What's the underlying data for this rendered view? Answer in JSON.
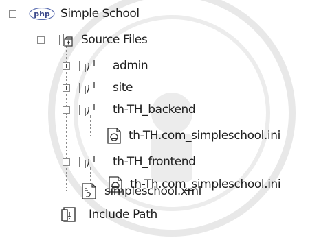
{
  "tree": {
    "root": {
      "label": "Simple School",
      "icon": "php-project-icon",
      "icon_text": "php",
      "expanded": true
    },
    "source_files": {
      "label": "Source Files",
      "icon": "source-folder-icon",
      "expanded": true
    },
    "admin": {
      "label": "admin",
      "icon": "package-folder-icon",
      "expanded": false
    },
    "site": {
      "label": "site",
      "icon": "package-folder-icon",
      "expanded": false
    },
    "th_backend": {
      "label": "th-TH_backend",
      "icon": "package-folder-icon",
      "expanded": true,
      "children": [
        {
          "label": "th-TH.com_simpleschool.ini",
          "icon": "ini-file-icon"
        }
      ]
    },
    "th_frontend": {
      "label": "th-TH_frontend",
      "icon": "package-folder-icon",
      "expanded": true,
      "children": [
        {
          "label": "th-Th.com_simpleschool.ini",
          "icon": "ini-file-icon"
        }
      ]
    },
    "xml_file": {
      "label": "simpleschool.xml",
      "icon": "xml-file-icon"
    },
    "include_path": {
      "label": "Include Path",
      "icon": "include-path-icon"
    }
  },
  "colors": {
    "php_logo_blue": "#5a6db0",
    "line": "#8c8c8c",
    "watermark": "#e3e3e3"
  }
}
